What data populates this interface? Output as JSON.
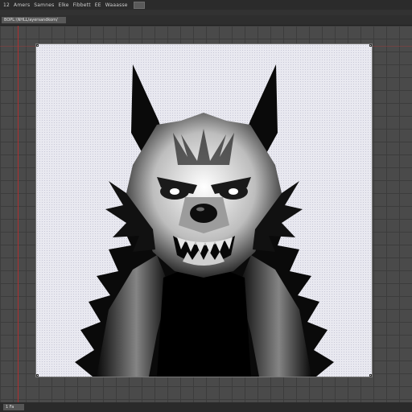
{
  "menu": {
    "items": [
      "12",
      "Amers",
      "Samnes",
      "Elke",
      "Fibbett",
      "EE",
      "Waaasse"
    ]
  },
  "document_tab": {
    "label": "BOPL:\\NHLL/ayersandkom/"
  },
  "status": {
    "text": "1 Fa"
  },
  "artwork": {
    "subject": "werewolf-illustration",
    "colors": {
      "ink": "#0a0a0a",
      "highlight": "#f2f2f2",
      "paper": "#e9e9f0"
    }
  },
  "colors": {
    "app_background": "#3b3b3b",
    "guide": "#b03030"
  }
}
